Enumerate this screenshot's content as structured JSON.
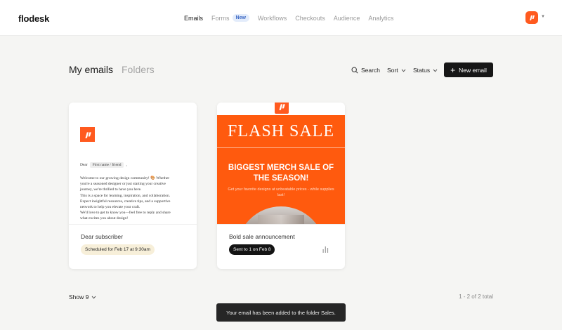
{
  "app": {
    "logo": "flodesk"
  },
  "nav": {
    "items": [
      {
        "label": "Emails",
        "active": true
      },
      {
        "label": "Forms",
        "badge": "New"
      },
      {
        "label": "Workflows"
      },
      {
        "label": "Checkouts"
      },
      {
        "label": "Audience"
      },
      {
        "label": "Analytics"
      }
    ]
  },
  "header": {
    "title": "My emails",
    "folders_tab": "Folders",
    "search_label": "Search",
    "sort_label": "Sort",
    "status_label": "Status",
    "new_email_label": "New email"
  },
  "cards": [
    {
      "name": "Dear subscriber",
      "status": "Scheduled for Feb 17 at 9:30am",
      "preview": {
        "dear": "Dear",
        "merge_tag": "First name / friend",
        "comma": ",",
        "body": [
          "Welcome to our growing design community! 🎨 Whether",
          "you're a seasoned designer or just starting your creative",
          "journey, we're thrilled to have you here.",
          "This is a space for learning, inspiration, and collaboration.",
          "Expect insightful resources, creative tips, and a supportive",
          "network to help you elevate your craft.",
          "We'd love to get to know you—feel free to reply and share",
          "what excites you about design!"
        ]
      }
    },
    {
      "name": "Bold sale announcement",
      "status": "Sent to 1 on Feb 8",
      "preview": {
        "flash": "FLASH SALE",
        "headline_1": "BIGGEST MERCH SALE OF",
        "headline_2": "THE SEASON!",
        "subline": "Get your favorite designs at unbeatable prices - while supplies last!"
      }
    }
  ],
  "footer": {
    "show_label": "Show 9",
    "pagination": "1 - 2 of 2 total"
  },
  "toast": {
    "message": "Your email has been added to the folder Sales."
  },
  "colors": {
    "brand": "#ff5a1f",
    "background": "#f5f5f3",
    "primary_button": "#161616"
  }
}
